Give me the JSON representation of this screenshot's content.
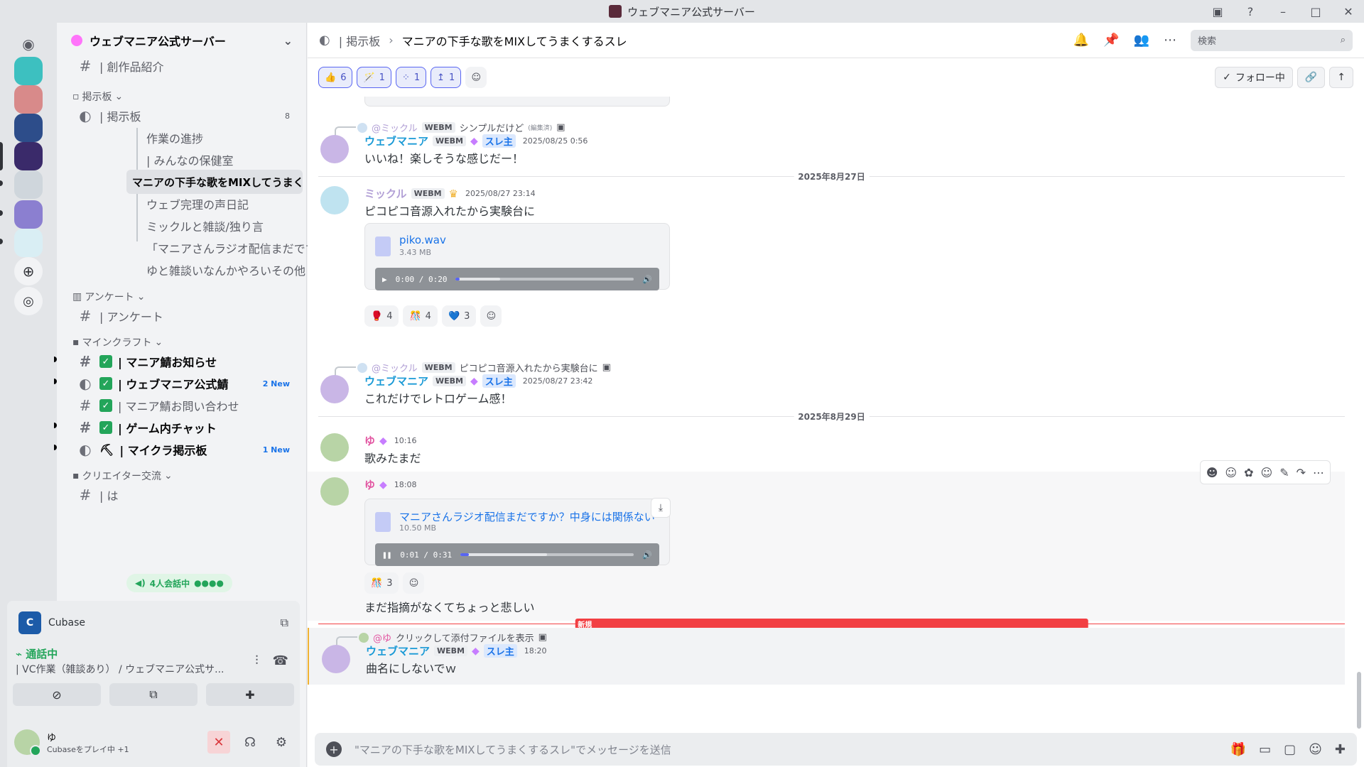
{
  "titlebar": {
    "title": "ウェブマニア公式サーバー"
  },
  "sidebar": {
    "server_name": "ウェブマニア公式サーバー",
    "cut_item": "| 創作品紹介",
    "categories": {
      "board": "掲示板",
      "survey": "アンケート",
      "minecraft": "マインクラフト",
      "creator": "クリエイター交流"
    },
    "forum": {
      "name": "| 掲示板",
      "count": "8"
    },
    "threads": [
      "作業の進捗",
      "| みんなの保健室",
      "マニアの下手な歌をMIXしてうまくす...",
      "ウェブ完理の声日記",
      "ミックルと雑談/独り言",
      "「マニアさんラジオ配信まだですか...",
      "ゆと雑談いなんかやろいその他"
    ],
    "survey_ch": "| アンケート",
    "mc_channels": [
      {
        "name": "| マニア鯖お知らせ",
        "badge": ""
      },
      {
        "name": "| ウェブマニア公式鯖",
        "badge": "2 New"
      },
      {
        "name": "| マニア鯖お問い合わせ",
        "badge": ""
      },
      {
        "name": "| ゲーム内チャット",
        "badge": ""
      },
      {
        "name": "| マイクラ掲示板",
        "badge": "1 New"
      }
    ],
    "creator_ch": "| は",
    "vc_pill": "4人会話中"
  },
  "voice": {
    "activity": "Cubase",
    "status": "通話中",
    "channel": "| VC作業（雑談あり） / ウェブマニア公式サ..."
  },
  "user": {
    "name": "ゆ",
    "status": "Cubaseをプレイ中 +1"
  },
  "header": {
    "crumb": "| 掲示板",
    "thread": "マニアの下手な歌をMIXしてうまくするスレ",
    "search_placeholder": "検索"
  },
  "top_reactions": [
    {
      "emoji": "👍",
      "count": "6"
    },
    {
      "emoji": "🪄",
      "count": "1"
    },
    {
      "emoji": "⁘",
      "count": "1"
    },
    {
      "emoji": "↥",
      "count": "1"
    }
  ],
  "follow_label": "フォロー中",
  "messages": {
    "m1": {
      "reply_name": "@ミックル",
      "reply_tag": "WEBM",
      "reply_text": "シンプルだけど",
      "reply_edited": "(編集済)",
      "name": "ウェブマニア",
      "tag": "WEBM",
      "role": "スレ主",
      "time": "2025/08/25 0:56",
      "text": "いいね！楽しそうな感じだー！"
    },
    "div1": "2025年8月27日",
    "m2": {
      "name": "ミックル",
      "tag": "WEBM",
      "time": "2025/08/27 23:14",
      "text": "ピコピコ音源入れたから実験台に",
      "file": "piko.wav",
      "size": "3.43 MB",
      "player_time": "0:00 / 0:20",
      "progress": 0.02,
      "reactions": [
        {
          "emoji": "🥊",
          "count": "4"
        },
        {
          "emoji": "🎊",
          "count": "4"
        },
        {
          "emoji": "💙",
          "count": "3"
        }
      ]
    },
    "m3": {
      "reply_name": "@ミックル",
      "reply_tag": "WEBM",
      "reply_text": "ピコピコ音源入れたから実験台に",
      "name": "ウェブマニア",
      "tag": "WEBM",
      "role": "スレ主",
      "time": "2025/08/27 23:42",
      "text": "これだけでレトロゲーム感！"
    },
    "div2": "2025年8月29日",
    "m4": {
      "name": "ゆ",
      "time": "10:16",
      "text": "歌みたまだ"
    },
    "m5": {
      "name": "ゆ",
      "time": "18:08",
      "file": "マニアさんラジオ配信まだですか？中身には関係ない",
      "size": "10.50 MB",
      "player_time": "0:01 / 0:31",
      "progress": 0.05,
      "reactions": [
        {
          "emoji": "🎊",
          "count": "3"
        }
      ],
      "text": "まだ指摘がなくてちょっと悲しい"
    },
    "new_label": "新規",
    "m6": {
      "reply_name": "@ゆ",
      "reply_text": "クリックして添付ファイルを表示",
      "name": "ウェブマニア",
      "tag": "WEBM",
      "role": "スレ主",
      "time": "18:20",
      "text": "曲名にしないでｗ"
    }
  },
  "composer": {
    "placeholder": "\"マニアの下手な歌をMIXしてうまくするスレ\"でメッセージを送信"
  },
  "colors": {
    "accent": "#5865f2",
    "brand_name": "#1a9ad6",
    "mikkuru": "#b2a0d6",
    "yu": "#e255a1",
    "online": "#23a55a",
    "new": "#f23f43"
  }
}
